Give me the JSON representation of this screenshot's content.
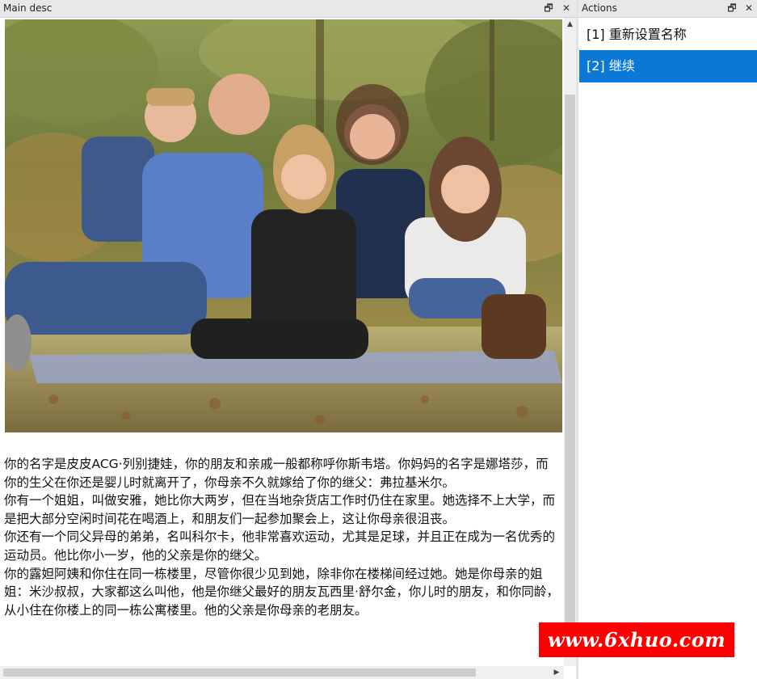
{
  "left_panel": {
    "title": "Main desc",
    "restore_glyph": "🗗",
    "close_glyph": "✕"
  },
  "right_panel": {
    "title": "Actions",
    "restore_glyph": "🗗",
    "close_glyph": "✕"
  },
  "actions": [
    {
      "label": "[1] 重新设置名称",
      "selected": false
    },
    {
      "label": "[2] 继续",
      "selected": true
    }
  ],
  "description": [
    "你的名字是皮皮ACG·列别捷娃，你的朋友和亲戚一般都称呼你斯韦塔。你妈妈的名字是娜塔莎，而你的生父在你还是婴儿时就离开了，你母亲不久就嫁给了你的继父：弗拉基米尔。",
    "你有一个姐姐，叫做安雅，她比你大两岁，但在当地杂货店工作时仍住在家里。她选择不上大学，而是把大部分空闲时间花在喝酒上，和朋友们一起参加聚会上，这让你母亲很沮丧。",
    "你还有一个同父异母的弟弟，名叫科尔卡，他非常喜欢运动，尤其是足球，并且正在成为一名优秀的运动员。他比你小一岁，他的父亲是你的继父。",
    "你的露妲阿姨和你住在同一栋楼里，尽管你很少见到她，除非你在楼梯间经过她。她是你母亲的姐姐：米沙叔叔，大家都这么叫他，他是你继父最好的朋友瓦西里·舒尔金，你儿时的朋友，和你同龄，从小住在你楼上的同一栋公寓楼里。他的父亲是你母亲的老朋友。"
  ],
  "scroll": {
    "up_glyph": "▲",
    "right_glyph": "▶"
  },
  "watermark": "www.6xhuo.com",
  "colors": {
    "selected_bg": "#0a78d7",
    "watermark_bg": "#ff0000"
  }
}
